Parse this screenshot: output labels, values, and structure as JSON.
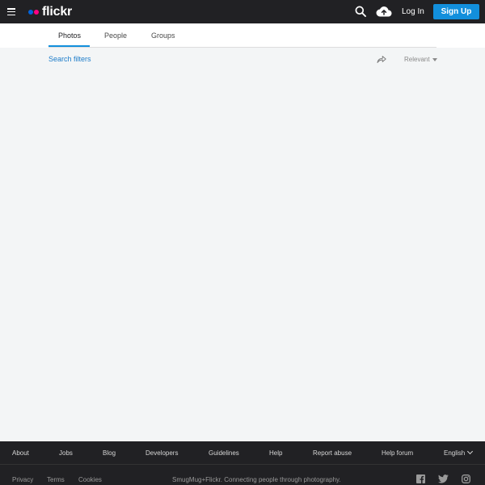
{
  "header": {
    "logo_text": "flickr",
    "login_label": "Log In",
    "signup_label": "Sign Up"
  },
  "tabs": [
    {
      "label": "Photos",
      "active": true
    },
    {
      "label": "People",
      "active": false
    },
    {
      "label": "Groups",
      "active": false
    }
  ],
  "toolbar": {
    "filters_label": "Search filters",
    "sort_label": "Relevant"
  },
  "footer": {
    "links": [
      "About",
      "Jobs",
      "Blog",
      "Developers",
      "Guidelines",
      "Help",
      "Report abuse",
      "Help forum"
    ],
    "language": "English",
    "bottom_links": [
      "Privacy",
      "Terms",
      "Cookies"
    ],
    "tagline": "SmugMug+Flickr. Connecting people through photography."
  },
  "colors": {
    "topbar": "#212124",
    "accent": "#128fdc",
    "logo_blue": "#0063dc",
    "logo_pink": "#ff0084",
    "page_bg": "#f3f5f6"
  },
  "icons": {
    "menu": "hamburger-icon",
    "search": "search-icon",
    "upload": "cloud-upload-icon",
    "share": "share-arrow-icon",
    "social": [
      "facebook-icon",
      "twitter-icon",
      "instagram-icon"
    ]
  }
}
